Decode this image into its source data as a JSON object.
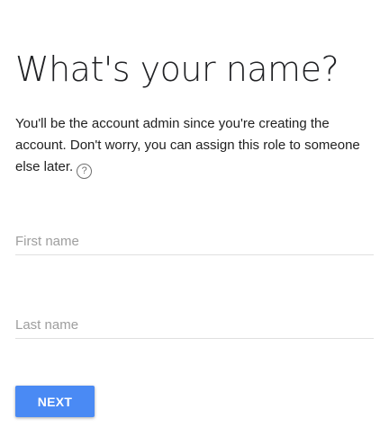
{
  "heading": "What's your name?",
  "description": "You'll be the account admin since you're creating the account. Don't worry, you can assign this role to someone else later.",
  "help_icon": {
    "name": "help-icon",
    "glyph": "?"
  },
  "form": {
    "first_name": {
      "placeholder": "First name",
      "value": ""
    },
    "last_name": {
      "placeholder": "Last name",
      "value": ""
    }
  },
  "actions": {
    "next_label": "NEXT"
  },
  "colors": {
    "accent": "#4a8af4",
    "text": "#212121",
    "placeholder": "#9e9e9e",
    "underline": "#e0e0e0"
  }
}
